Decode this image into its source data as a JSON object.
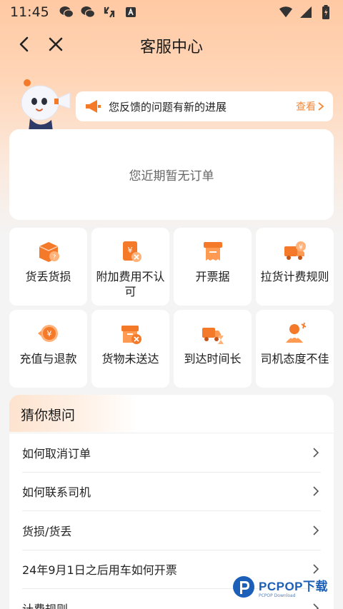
{
  "status_bar": {
    "time": "11:45"
  },
  "nav": {
    "title": "客服中心"
  },
  "notice": {
    "text": "您反馈的问题有新的进展",
    "link": "查看"
  },
  "order": {
    "empty_text": "您近期暂无订单"
  },
  "services": [
    {
      "label": "货丢货损",
      "icon": "box-question-icon"
    },
    {
      "label": "附加费用不认可",
      "icon": "receipt-x-icon"
    },
    {
      "label": "开票据",
      "icon": "invoice-icon"
    },
    {
      "label": "拉货计费规则",
      "icon": "truck-coin-icon"
    },
    {
      "label": "充值与退款",
      "icon": "coin-refund-icon"
    },
    {
      "label": "货物未送达",
      "icon": "box-x-icon"
    },
    {
      "label": "到达时间长",
      "icon": "truck-hourglass-icon"
    },
    {
      "label": "司机态度不佳",
      "icon": "driver-icon"
    }
  ],
  "guess": {
    "title": "猜你想问",
    "items": [
      "如何取消订单",
      "如何联系司机",
      "货损/货丢",
      "24年9月1日之后用车如何开票",
      "计费规则"
    ]
  },
  "watermark": {
    "main": "PCPOP下载",
    "sub": "PCPOP Download"
  },
  "colors": {
    "accent": "#f08a3c",
    "header_bg": "#ffc9a3",
    "icon_orange": "#f47a2a"
  }
}
